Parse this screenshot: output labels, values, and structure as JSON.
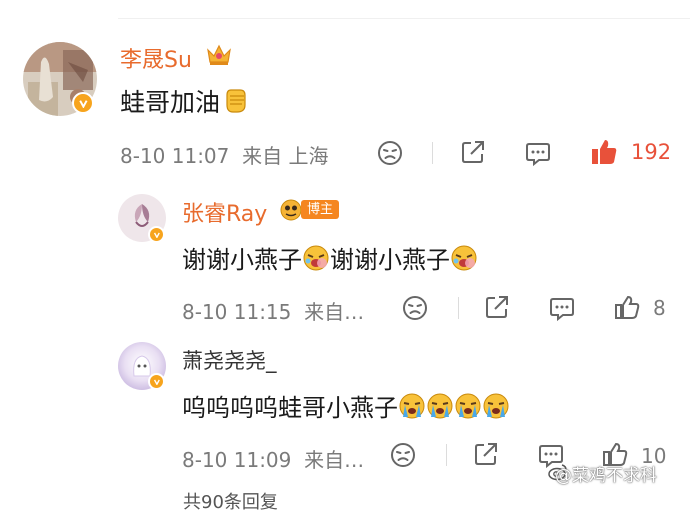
{
  "comments": [
    {
      "user": "李晟Su",
      "text": "蛙哥加油",
      "time": "8-10 11:07",
      "from": "来自 上海",
      "likes": "192"
    },
    {
      "user": "张睿Ray",
      "badge": "博主",
      "text1": "谢谢小燕子",
      "text2": "谢谢小燕子",
      "time": "8-10 11:15",
      "from": "来自…",
      "likes": "8"
    },
    {
      "user": "萧尧尧尧_",
      "text": "呜呜呜呜蛙哥小燕子",
      "time": "8-10 11:09",
      "from": "来自…",
      "likes": "10"
    }
  ],
  "watermark": "@菜鸡不求科",
  "next_partial": "共90条回复",
  "colors": {
    "name": "#e86b2d",
    "like_active": "#e8513a",
    "meta": "#7a7a7a",
    "verified": "#f7a41d"
  },
  "icons": [
    "crown-icon",
    "verified-badge-icon",
    "fist-emoji-icon",
    "dislike-face-icon",
    "share-icon",
    "comment-icon",
    "like-thumb-icon",
    "laugh-cry-emoji-icon",
    "cry-emoji-icon",
    "weibo-logo-icon"
  ]
}
